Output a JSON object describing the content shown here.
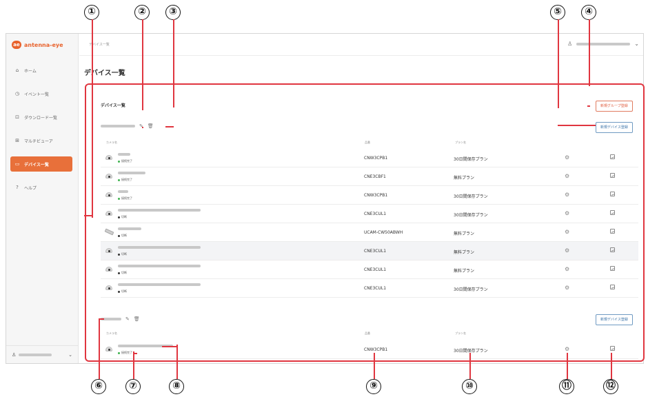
{
  "app": {
    "logo_mark": "ae",
    "logo_text": "antenna-eye",
    "breadcrumb": "デバイス一覧"
  },
  "sidebar": {
    "items": [
      {
        "label": "ホーム",
        "icon": "home-icon",
        "glyph": "⌂"
      },
      {
        "label": "イベント一覧",
        "icon": "event-icon",
        "glyph": "◷"
      },
      {
        "label": "ダウンロード一覧",
        "icon": "download-icon",
        "glyph": "⊡"
      },
      {
        "label": "マルチビューア",
        "icon": "grid-icon",
        "glyph": "⊞"
      },
      {
        "label": "デバイス一覧",
        "icon": "device-icon",
        "glyph": "▭",
        "active": true
      },
      {
        "label": "ヘルプ",
        "icon": "help-icon",
        "glyph": "?"
      }
    ]
  },
  "page": {
    "title": "デバイス一覧",
    "section_title": "デバイス一覧",
    "new_group_button": "新規グループ登録",
    "new_device_button": "新規デバイス登録",
    "columns": {
      "camera": "カメラ名",
      "model": "品番",
      "plan": "プラン名"
    },
    "groups": [
      {
        "rows": [
          {
            "type": "dome",
            "status": "接続完了",
            "status_color": "#3fb34f",
            "model": "CNW3CPB1",
            "plan": "30日間保存プラン"
          },
          {
            "type": "dome",
            "status": "接続完了",
            "status_color": "#3fb34f",
            "model": "CNE3CBF1",
            "plan": "無料プラン"
          },
          {
            "type": "dome",
            "status": "接続完了",
            "status_color": "#3fb34f",
            "model": "CNW3CPB1",
            "plan": "30日間保存プラン"
          },
          {
            "type": "dome",
            "status": "切断",
            "status_color": "#333333",
            "model": "CNE3CUL1",
            "plan": "30日間保存プラン"
          },
          {
            "type": "bullet",
            "status": "切断",
            "status_color": "#333333",
            "model": "UCAM-CW50ABWH",
            "plan": "無料プラン"
          },
          {
            "type": "dome",
            "status": "切断",
            "status_color": "#333333",
            "model": "CNE3CUL1",
            "plan": "無料プラン",
            "highlight": true
          },
          {
            "type": "dome",
            "status": "切断",
            "status_color": "#333333",
            "model": "CNE3CUL1",
            "plan": "無料プラン"
          },
          {
            "type": "dome",
            "status": "切断",
            "status_color": "#333333",
            "model": "CNE3CUL1",
            "plan": "30日間保存プラン"
          }
        ]
      },
      {
        "rows": [
          {
            "type": "dome",
            "status": "接続完了",
            "status_color": "#3fb34f",
            "model": "CNW3CPB1",
            "plan": "30日間保存プラン"
          }
        ]
      }
    ]
  },
  "callouts": [
    "①",
    "②",
    "③",
    "④",
    "⑤",
    "⑥",
    "⑦",
    "⑧",
    "⑨",
    "⑩",
    "⑪",
    "⑫"
  ],
  "colors": {
    "accent": "#e8703a",
    "annotation": "#e0353f",
    "link_blue": "#3b73a8"
  }
}
